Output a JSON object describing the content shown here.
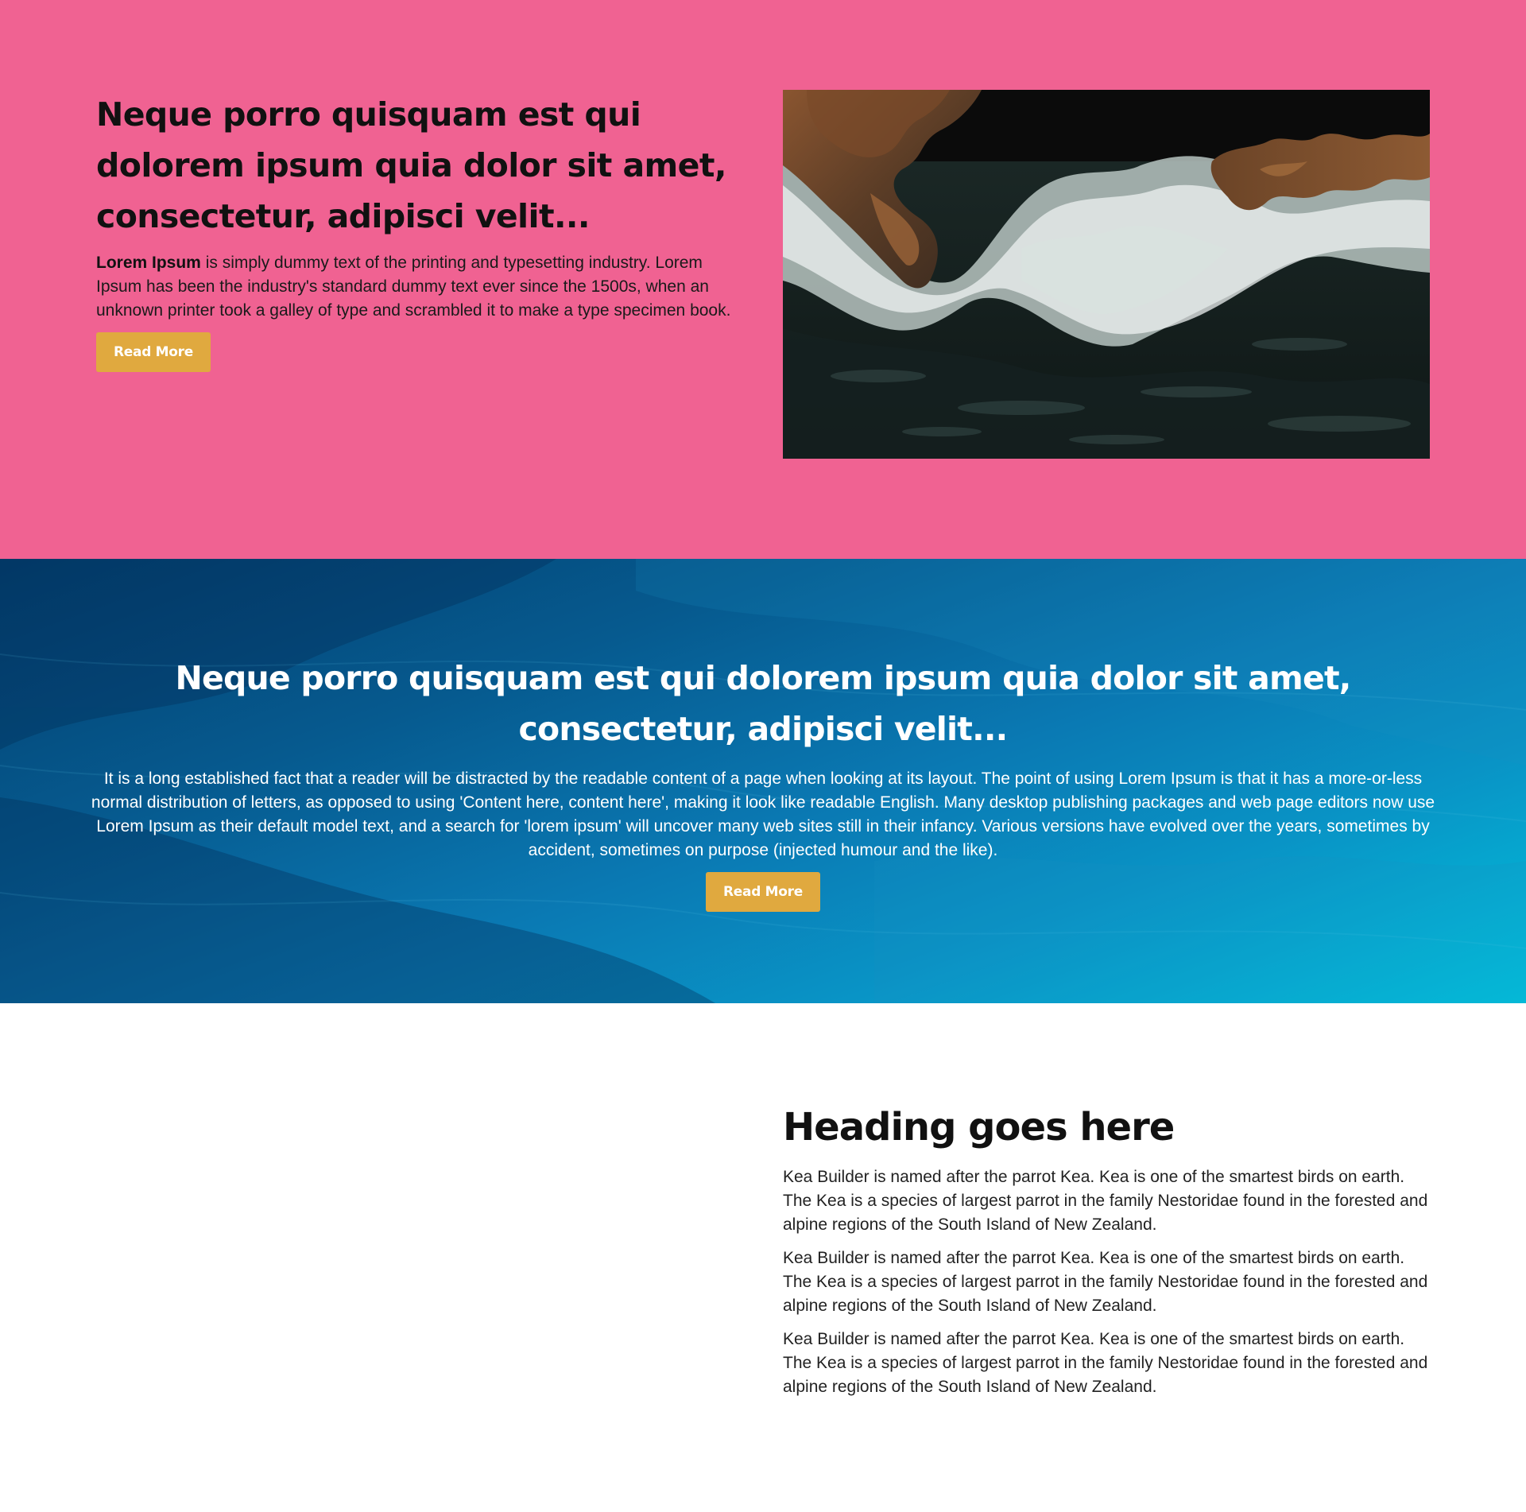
{
  "hero": {
    "title": "Neque porro quisquam est qui dolorem ipsum quia dolor sit amet, consectetur, adipisci velit...",
    "body_bold": "Lorem Ipsum",
    "body_rest": " is simply dummy text of the printing and typesetting industry. Lorem Ipsum has been the industry's standard dummy text ever since the 1500s, when an unknown printer took a galley of type and scrambled it to make a type specimen book.",
    "button_label": "Read More",
    "background_color": "#f06292",
    "button_color": "#e0a93f"
  },
  "ocean": {
    "title": "Neque porro quisquam est qui dolorem ipsum quia dolor sit amet, consectetur, adipisci velit...",
    "body": "It is a long established fact that a reader will be distracted by the readable content of a page when looking at its layout. The point of using Lorem Ipsum is that it has a more-or-less normal distribution of letters, as opposed to using 'Content here, content here', making it look like readable English. Many desktop publishing packages and web page editors now use Lorem Ipsum as their default model text, and a search for 'lorem ipsum' will uncover many web sites still in their infancy. Various versions have evolved over the years, sometimes by accident, sometimes on purpose (injected humour and the like).",
    "button_label": "Read More"
  },
  "content": {
    "heading": "Heading goes here",
    "paragraphs": [
      "Kea Builder is named after the parrot Kea. Kea is one of the smartest birds on earth. The Kea is a species of largest parrot in the family Nestoridae found in the forested and alpine regions of the South Island of New Zealand.",
      "Kea Builder is named after the parrot Kea. Kea is one of the smartest birds on earth. The Kea is a species of largest parrot in the family Nestoridae found in the forested and alpine regions of the South Island of New Zealand.",
      "Kea Builder is named after the parrot Kea. Kea is one of the smartest birds on earth. The Kea is a species of largest parrot in the family Nestoridae found in the forested and alpine regions of the South Island of New Zealand."
    ]
  }
}
